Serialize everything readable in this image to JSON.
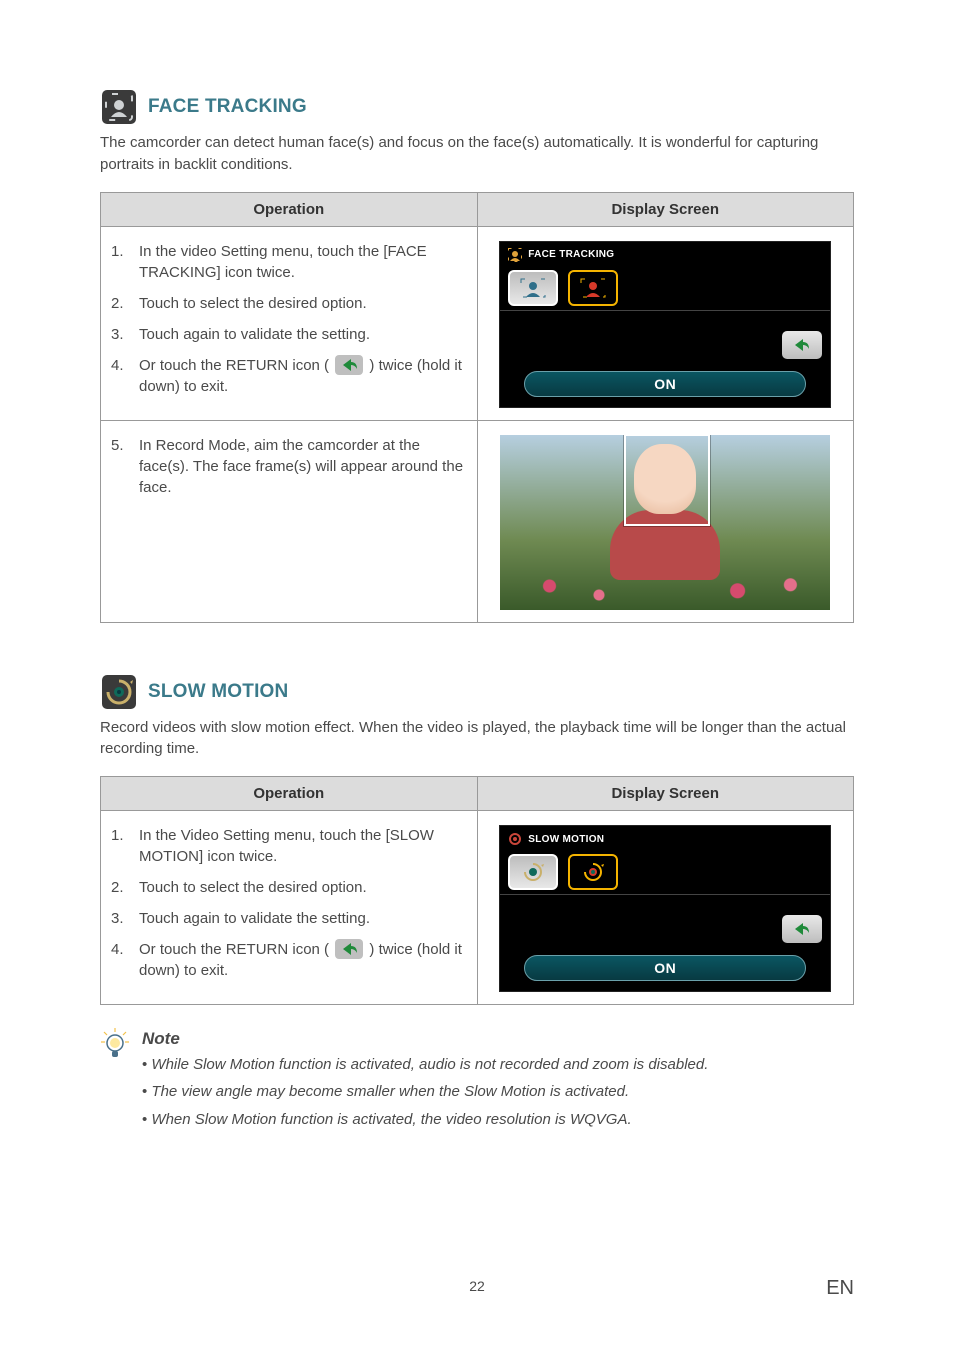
{
  "section1": {
    "title": "FACE TRACKING",
    "intro": "The camcorder can detect human face(s) and focus on the face(s) automatically. It is wonderful for capturing portraits in backlit conditions.",
    "headers": {
      "operation": "Operation",
      "display": "Display Screen"
    },
    "steps": {
      "s1": "In the video Setting menu, touch the [FACE TRACKING] icon twice.",
      "s2": "Touch to select the desired option.",
      "s3": "Touch again to validate the setting.",
      "s4a": "Or touch the RETURN icon (",
      "s4b": ") twice (hold it down) to exit.",
      "s5": "In Record Mode, aim the camcorder at the face(s). The face frame(s) will appear around the face."
    },
    "screen": {
      "title": "FACE TRACKING",
      "pill": "ON"
    }
  },
  "section2": {
    "title": "SLOW MOTION",
    "intro": "Record videos with slow motion effect. When the video is played, the playback time will be longer than the actual recording time.",
    "headers": {
      "operation": "Operation",
      "display": "Display Screen"
    },
    "steps": {
      "s1": "In the Video Setting menu, touch the [SLOW MOTION] icon twice.",
      "s2": "Touch to select the desired option.",
      "s3": "Touch again to validate the setting.",
      "s4a": "Or touch the RETURN icon (",
      "s4b": ") twice (hold it down) to exit."
    },
    "screen": {
      "title": "SLOW MOTION",
      "pill": "ON"
    }
  },
  "note": {
    "title": "Note",
    "items": {
      "n1": "While Slow Motion function is activated, audio is not recorded and zoom is disabled.",
      "n2": "The view angle may become smaller when the Slow Motion is activated.",
      "n3": "When Slow Motion function is activated, the video resolution is WQVGA."
    }
  },
  "footer": {
    "page": "22",
    "lang": "EN"
  }
}
